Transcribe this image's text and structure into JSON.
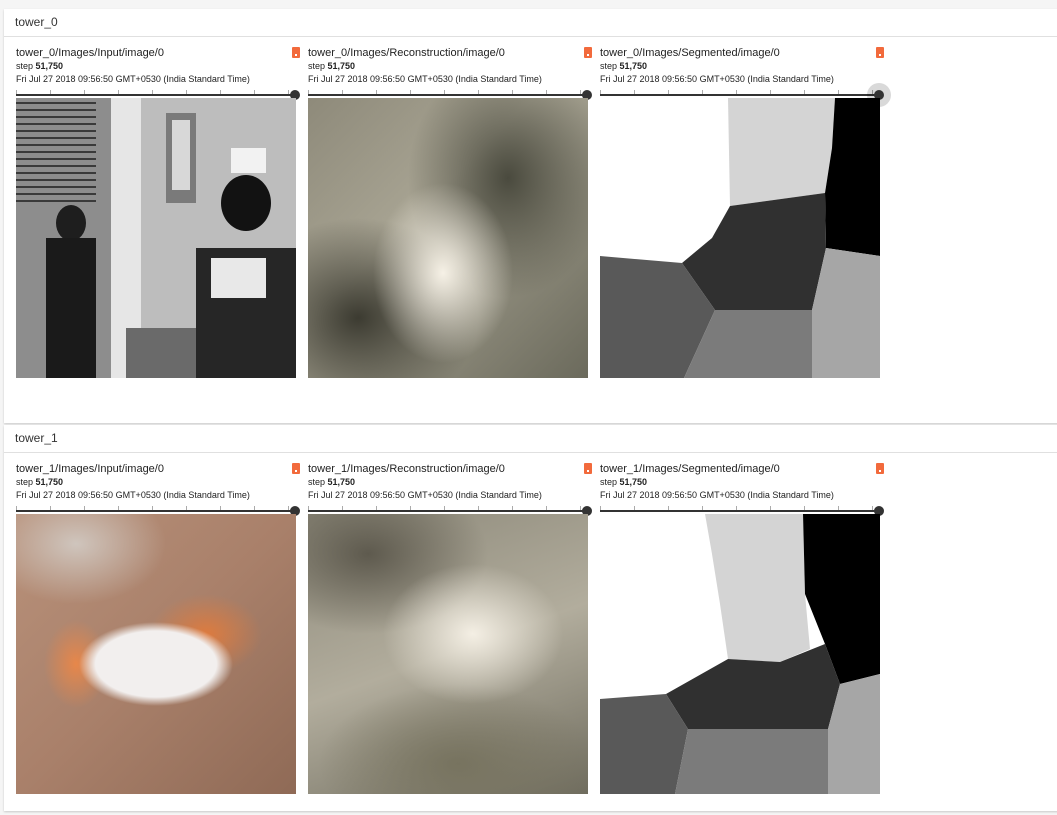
{
  "groups": [
    {
      "name": "tower_0",
      "cards": [
        {
          "title": "tower_0/Images/Input/image/0",
          "step_label": "step",
          "step_value": "51,750",
          "time": "Fri Jul 27 2018 09:56:50 GMT+0530 (India Standard Time)",
          "image": "input"
        },
        {
          "title": "tower_0/Images/Reconstruction/image/0",
          "step_label": "step",
          "step_value": "51,750",
          "time": "Fri Jul 27 2018 09:56:50 GMT+0530 (India Standard Time)",
          "image": "reconstruction"
        },
        {
          "title": "tower_0/Images/Segmented/image/0",
          "step_label": "step",
          "step_value": "51,750",
          "time": "Fri Jul 27 2018 09:56:50 GMT+0530 (India Standard Time)",
          "image": "segmented"
        }
      ]
    },
    {
      "name": "tower_1",
      "cards": [
        {
          "title": "tower_1/Images/Input/image/0",
          "step_label": "step",
          "step_value": "51,750",
          "time": "Fri Jul 27 2018 09:56:50 GMT+0530 (India Standard Time)",
          "image": "input"
        },
        {
          "title": "tower_1/Images/Reconstruction/image/0",
          "step_label": "step",
          "step_value": "51,750",
          "time": "Fri Jul 27 2018 09:56:50 GMT+0530 (India Standard Time)",
          "image": "reconstruction"
        },
        {
          "title": "tower_1/Images/Segmented/image/0",
          "step_label": "step",
          "step_value": "51,750",
          "time": "Fri Jul 27 2018 09:56:50 GMT+0530 (India Standard Time)",
          "image": "segmented"
        }
      ]
    }
  ],
  "icons": {
    "card_menu": "menu-dot-icon"
  },
  "colors": {
    "accent": "#f26a3c",
    "slider": "#333333"
  }
}
